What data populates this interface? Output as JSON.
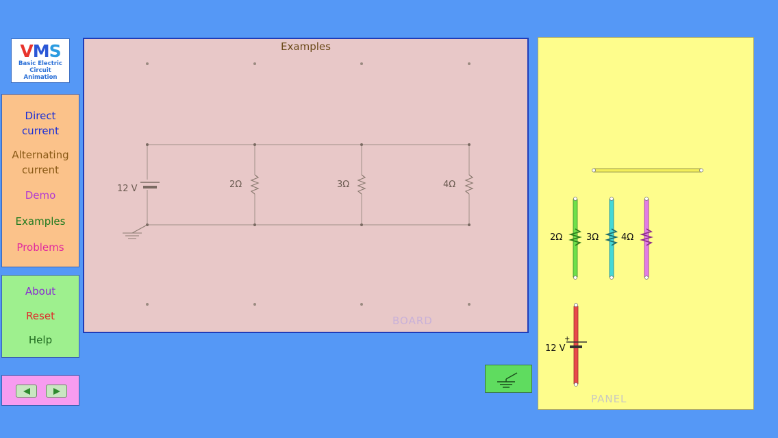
{
  "logo": {
    "letter_v": "V",
    "letter_m": "M",
    "letter_s": "S",
    "line1": "Basic Electric",
    "line2": "Circuit",
    "line3": "Animation"
  },
  "menu": {
    "direct_current": [
      "Direct",
      "current"
    ],
    "alternating_current": [
      "Alternating",
      "current"
    ],
    "demo": "Demo",
    "examples": "Examples",
    "problems": "Problems",
    "about": "About",
    "reset": "Reset",
    "help": "Help"
  },
  "board": {
    "title": "Examples",
    "label": "BOARD",
    "battery_label": "12 V",
    "resistors": [
      "2Ω",
      "3Ω",
      "4Ω"
    ]
  },
  "panel": {
    "label": "PANEL",
    "resistors": [
      "2Ω",
      "3Ω",
      "4Ω"
    ],
    "battery_label": "12 V",
    "battery_plus": "+"
  },
  "colors": {
    "background": "#5598f6",
    "board": "#e8c8c8",
    "panel": "#fefd8c",
    "resistor_2": "#6fe04a",
    "resistor_3": "#44d8d6",
    "resistor_4": "#e27ce4",
    "battery": "#e84a4a",
    "wire": "#f3ee5a"
  },
  "icons": {
    "prev": "left-arrow-icon",
    "next": "right-arrow-icon",
    "ground": "ground-icon"
  }
}
